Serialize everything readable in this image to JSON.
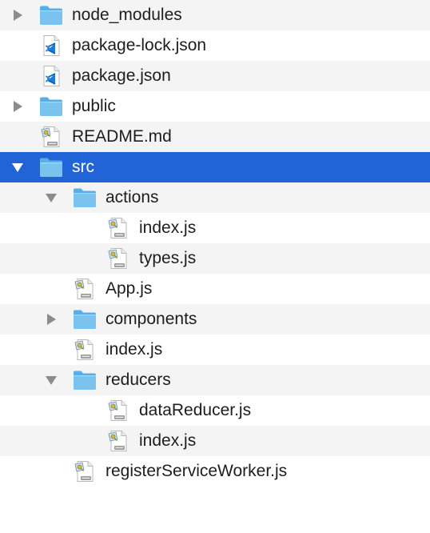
{
  "file_tree": {
    "items": [
      {
        "label": "node_modules",
        "kind": "folder",
        "depth": 0,
        "expanded": false,
        "selected": false
      },
      {
        "label": "package-lock.json",
        "kind": "vscode-file",
        "depth": 0,
        "expanded": null,
        "selected": false
      },
      {
        "label": "package.json",
        "kind": "vscode-file",
        "depth": 0,
        "expanded": null,
        "selected": false
      },
      {
        "label": "public",
        "kind": "folder",
        "depth": 0,
        "expanded": false,
        "selected": false
      },
      {
        "label": "README.md",
        "kind": "text-file",
        "depth": 0,
        "expanded": null,
        "selected": false
      },
      {
        "label": "src",
        "kind": "folder",
        "depth": 0,
        "expanded": true,
        "selected": true
      },
      {
        "label": "actions",
        "kind": "folder",
        "depth": 1,
        "expanded": true,
        "selected": false
      },
      {
        "label": "index.js",
        "kind": "text-file",
        "depth": 2,
        "expanded": null,
        "selected": false
      },
      {
        "label": "types.js",
        "kind": "text-file",
        "depth": 2,
        "expanded": null,
        "selected": false
      },
      {
        "label": "App.js",
        "kind": "text-file",
        "depth": 1,
        "expanded": null,
        "selected": false
      },
      {
        "label": "components",
        "kind": "folder",
        "depth": 1,
        "expanded": false,
        "selected": false
      },
      {
        "label": "index.js",
        "kind": "text-file",
        "depth": 1,
        "expanded": null,
        "selected": false
      },
      {
        "label": "reducers",
        "kind": "folder",
        "depth": 1,
        "expanded": true,
        "selected": false
      },
      {
        "label": "dataReducer.js",
        "kind": "text-file",
        "depth": 2,
        "expanded": null,
        "selected": false
      },
      {
        "label": "index.js",
        "kind": "text-file",
        "depth": 2,
        "expanded": null,
        "selected": false
      },
      {
        "label": "registerServiceWorker.js",
        "kind": "text-file",
        "depth": 1,
        "expanded": null,
        "selected": false
      }
    ]
  },
  "colors": {
    "selection": "#2164d7",
    "stripe": "#f4f4f4",
    "folder": "#6cb8ea",
    "disclosure": "#8c8c8c"
  }
}
